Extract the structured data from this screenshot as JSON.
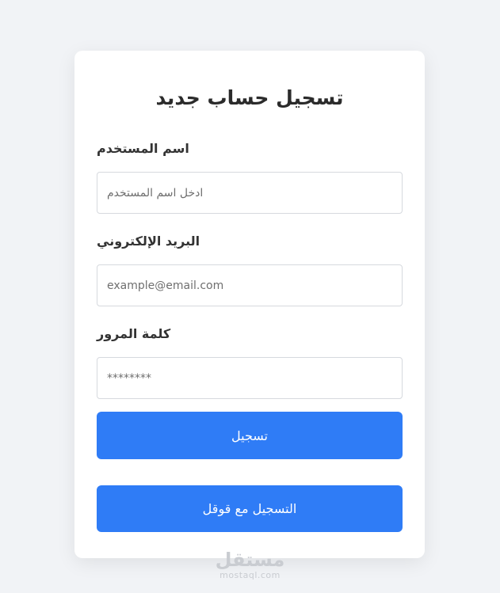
{
  "form": {
    "title": "تسجيل حساب جديد",
    "username": {
      "label": "اسم المستخدم",
      "placeholder": "ادخل اسم المستخدم"
    },
    "email": {
      "label": "البريد الإلكتروني",
      "placeholder": "example@email.com"
    },
    "password": {
      "label": "كلمة المرور",
      "placeholder": "********"
    },
    "submit_label": "تسجيل",
    "google_label": "التسجيل مع قوقل"
  },
  "watermark": {
    "arabic": "مستقل",
    "latin": "mostaql.com"
  },
  "colors": {
    "background": "#f1f3f6",
    "card": "#ffffff",
    "primary": "#2f7cf6",
    "text": "#2b2b2b"
  }
}
